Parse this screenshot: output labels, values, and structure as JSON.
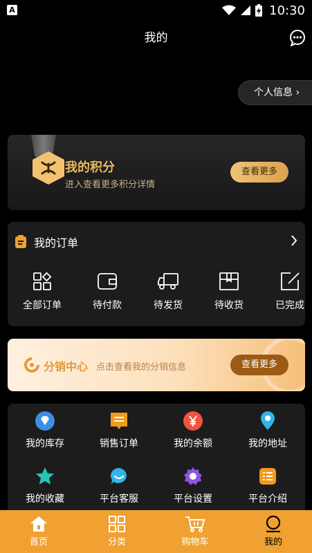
{
  "status_bar": {
    "time": "10:30",
    "app_badge": "A"
  },
  "header": {
    "title": "我的"
  },
  "profile": {
    "label": "个人信息 ›"
  },
  "points": {
    "title": "我的积分",
    "subtitle": "进入查看更多积分详情",
    "button": "查看更多"
  },
  "orders": {
    "title": "我的订单",
    "items": [
      {
        "label": "全部订单",
        "icon": "grid-icon"
      },
      {
        "label": "待付款",
        "icon": "wallet-icon"
      },
      {
        "label": "待发货",
        "icon": "truck-icon"
      },
      {
        "label": "待收货",
        "icon": "box-icon"
      },
      {
        "label": "已完成",
        "icon": "edit-icon"
      }
    ]
  },
  "distribution": {
    "title": "分销中心",
    "subtitle": "点击查看我的分销信息",
    "button": "查看更多"
  },
  "services": {
    "items": [
      {
        "label": "我的库存",
        "icon": "diamond-icon",
        "color": "#3d8de8"
      },
      {
        "label": "销售订单",
        "icon": "receipt-icon",
        "color": "#f39a1e"
      },
      {
        "label": "我的余额",
        "icon": "yen-icon",
        "color": "#f0543c"
      },
      {
        "label": "我的地址",
        "icon": "location-pin-icon",
        "color": "#2fb6e9"
      },
      {
        "label": "我的收藏",
        "icon": "star-icon",
        "color": "#27c4b4"
      },
      {
        "label": "平台客服",
        "icon": "chat-icon",
        "color": "#2fb6e9"
      },
      {
        "label": "平台设置",
        "icon": "gear-icon",
        "color": "#8a56e2"
      },
      {
        "label": "平台介绍",
        "icon": "list-icon",
        "color": "#f39a1e"
      }
    ]
  },
  "tabbar": {
    "items": [
      {
        "label": "首页",
        "icon": "home-icon"
      },
      {
        "label": "分类",
        "icon": "category-icon"
      },
      {
        "label": "购物车",
        "icon": "cart-icon"
      },
      {
        "label": "我的",
        "icon": "profile-icon",
        "active": true
      }
    ]
  },
  "colors": {
    "accent": "#f0a131",
    "gold": "#e8b960",
    "background": "#000000",
    "card": "#1c1c1c"
  }
}
